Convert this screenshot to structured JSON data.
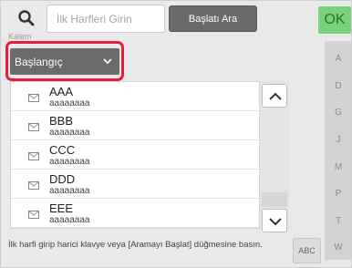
{
  "search": {
    "placeholder": "İlk Harfleri Girin",
    "button_label": "Başlatı Ara",
    "ok_label": "OK"
  },
  "section_label": "Kalem",
  "dropdown": {
    "selected": "Başlangıç"
  },
  "list": {
    "items": [
      {
        "name": "AAA",
        "sub": "aaaaaaaa",
        "icon": "envelope-icon"
      },
      {
        "name": "BBB",
        "sub": "aaaaaaaa",
        "icon": "envelope-icon"
      },
      {
        "name": "CCC",
        "sub": "aaaaaaaa",
        "icon": "envelope-icon"
      },
      {
        "name": "DDD",
        "sub": "aaaaaaaa",
        "icon": "envelope-icon"
      },
      {
        "name": "EEE",
        "sub": "aaaaaaaa",
        "icon": "envelope-icon"
      }
    ]
  },
  "index_letters": [
    "A",
    "D",
    "G",
    "J",
    "M",
    "P",
    "T",
    "W"
  ],
  "footer": {
    "hint": "İlk harfi girip harici klavye veya [Aramayı Başlat] düğmesine basın.",
    "abc_label": "ABC"
  },
  "colors": {
    "highlight": "#e0203a",
    "ok_bg": "#7bd07b",
    "button_bg": "#6a6a6a"
  }
}
